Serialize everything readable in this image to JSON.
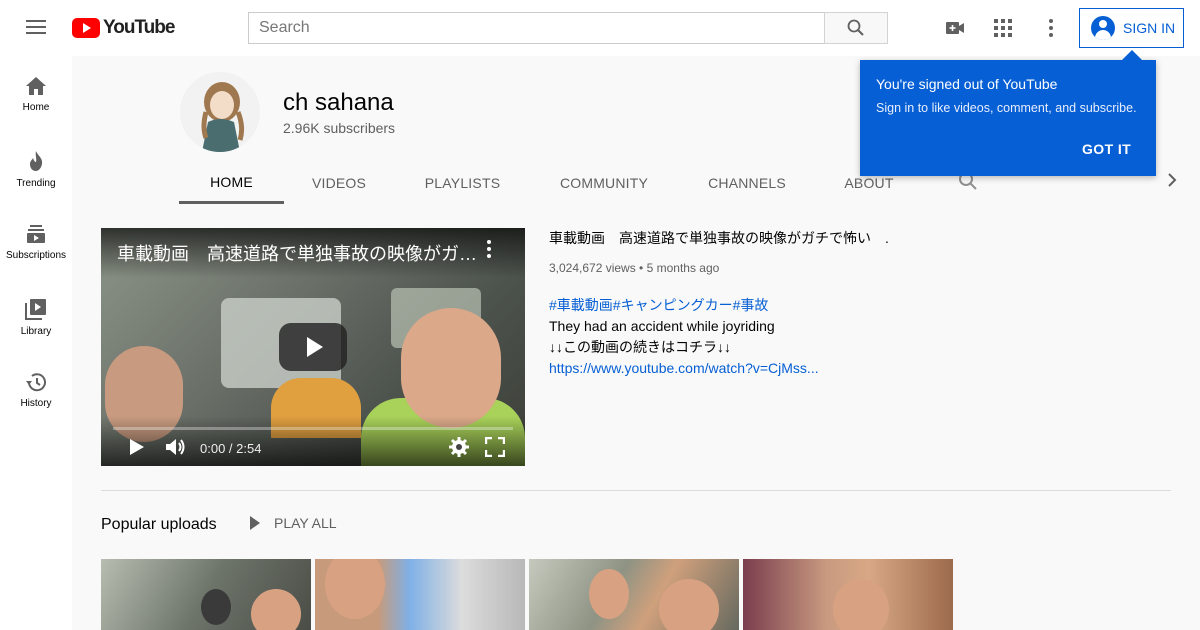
{
  "header": {
    "logo_text": "YouTube",
    "search_placeholder": "Search",
    "sign_in_label": "SIGN IN"
  },
  "sidebar": {
    "items": [
      {
        "label": "Home",
        "icon": "home-icon"
      },
      {
        "label": "Trending",
        "icon": "fire-icon"
      },
      {
        "label": "Subscriptions",
        "icon": "subscriptions-icon"
      },
      {
        "label": "Library",
        "icon": "library-icon"
      },
      {
        "label": "History",
        "icon": "history-icon"
      }
    ]
  },
  "channel": {
    "name": "ch sahana",
    "subscribers": "2.96K subscribers"
  },
  "tabs": [
    "HOME",
    "VIDEOS",
    "PLAYLISTS",
    "COMMUNITY",
    "CHANNELS",
    "ABOUT"
  ],
  "active_tab": "HOME",
  "featured": {
    "player_title": "車載動画　高速道路で単独事故の映像がガチで怖い　.",
    "time": "0:00 / 2:54",
    "title": "車載動画　高速道路で単独事故の映像がガチで怖い　.",
    "meta": "3,024,672 views • 5 months ago",
    "hashtags": "#車載動画#キャンピングカー#事故",
    "desc_line1": "They had an accident while joyriding",
    "desc_line2": "↓↓この動画の続きはコチラ↓↓",
    "link": "https://www.youtube.com/watch?v=CjMss..."
  },
  "popular": {
    "title": "Popular uploads",
    "play_all": "PLAY ALL"
  },
  "popup": {
    "title": "You're signed out of YouTube",
    "subtitle": "Sign in to like videos, comment, and subscribe.",
    "button": "GOT IT"
  },
  "colors": {
    "brand_red": "#ff0000",
    "accent_blue": "#065fd4"
  }
}
